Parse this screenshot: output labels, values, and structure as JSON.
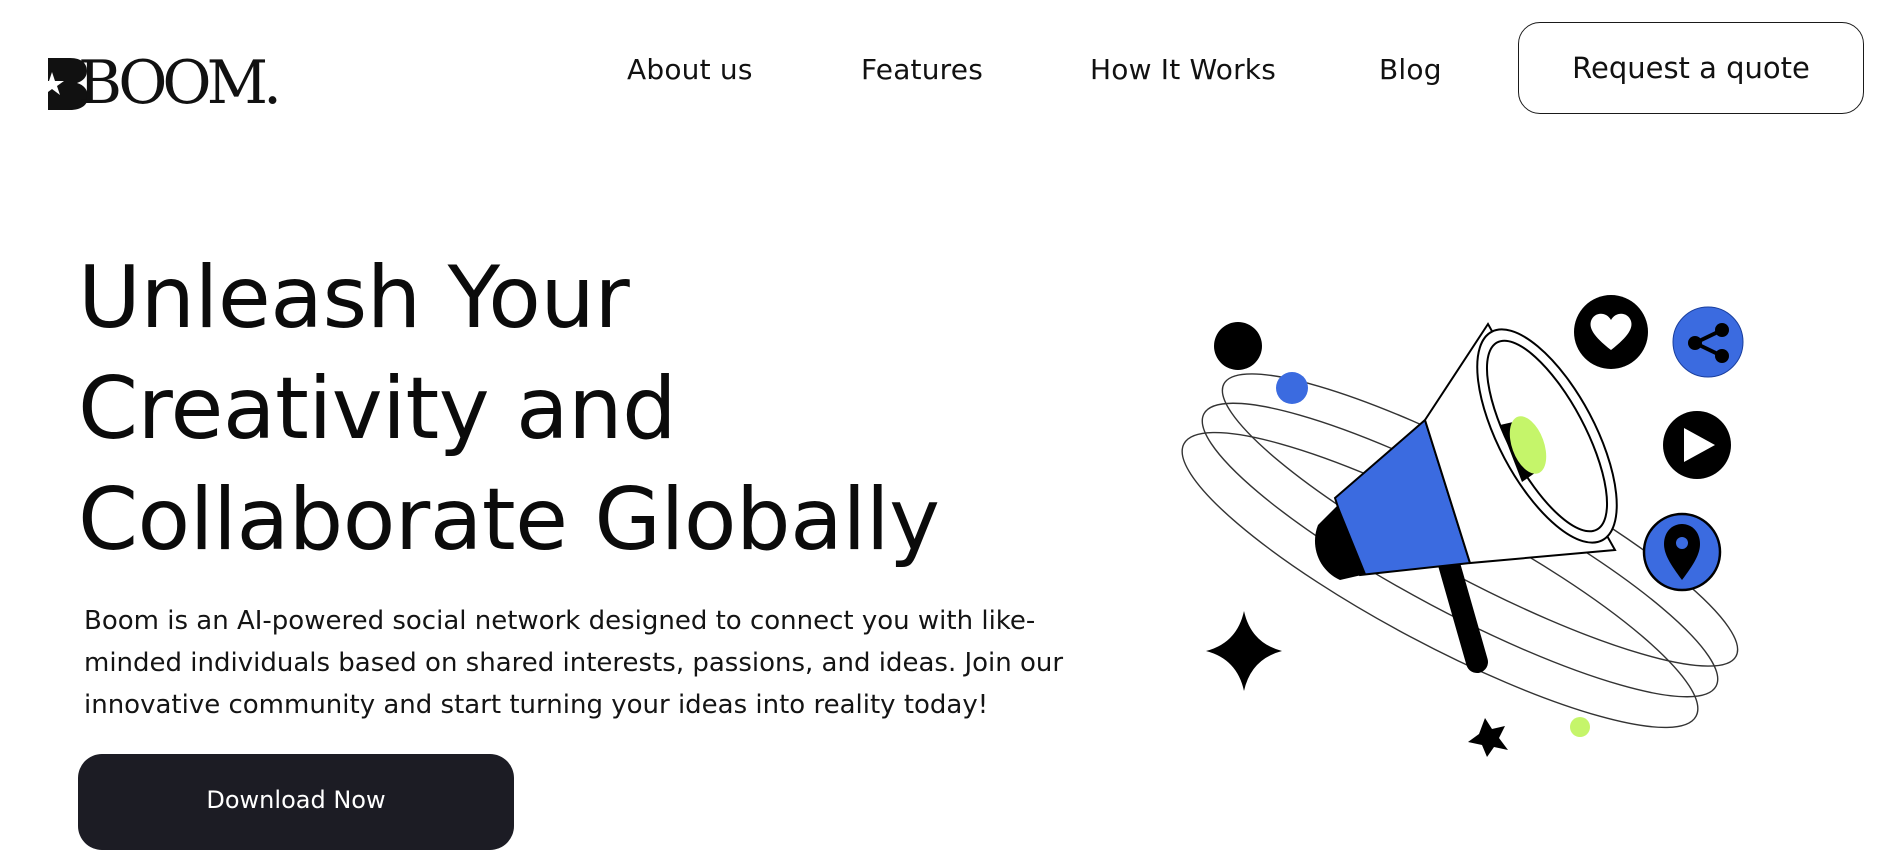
{
  "brand": {
    "logo_text": "BOOM."
  },
  "nav": {
    "items": [
      {
        "label": "About us"
      },
      {
        "label": "Features"
      },
      {
        "label": "How It Works"
      },
      {
        "label": "Blog"
      }
    ],
    "cta_label": "Request a quote"
  },
  "hero": {
    "title_lines": [
      "Unleash Your",
      "Creativity and",
      "Collaborate Globally"
    ],
    "description": "Boom is an AI-powered social network designed to connect you with like-minded individuals based on shared interests, passions, and ideas. Join our innovative community and start turning your ideas into reality today!",
    "cta_label": "Download Now"
  },
  "illustration": {
    "icons": [
      "megaphone-icon",
      "heart-icon",
      "share-icon",
      "play-icon",
      "location-pin-icon",
      "sparkle-icon",
      "star-icon"
    ]
  },
  "colors": {
    "accent_blue": "#3b6be0",
    "accent_lime": "#c5f56a",
    "dark": "#1c1c24"
  }
}
